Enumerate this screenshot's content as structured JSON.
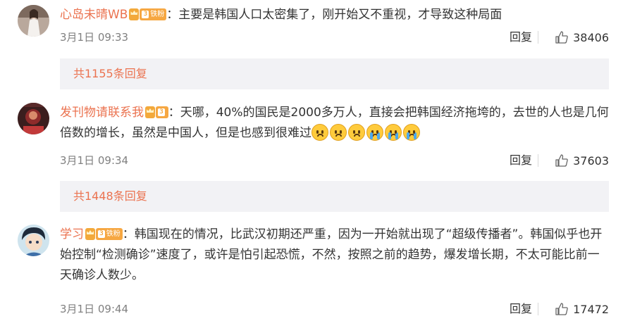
{
  "comments": [
    {
      "username": "心岛未晴WB",
      "badge_text": "铁粉",
      "text": "：主要是韩国人口太密集了，刚开始又不重视，才导致这种局面",
      "time": "3月1日 09:33",
      "reply_label": "回复",
      "likes": "38406",
      "reply_count_text": "共1155条回复"
    },
    {
      "username": "发刊物请联系我",
      "badge_text": "",
      "text": "：天哪，40%的国民是2000多万人，直接会把韩国经济拖垮的，去世的人也是几何倍数的增长，虽然是中国人，但是也感到很难过",
      "emojis": [
        "sad-face-icon",
        "sad-face-icon",
        "sad-face-icon",
        "crying-face-icon",
        "crying-face-icon",
        "crying-face-icon"
      ],
      "time": "3月1日 09:34",
      "reply_label": "回复",
      "likes": "37603",
      "reply_count_text": "共1448条回复"
    },
    {
      "username": "学习",
      "badge_text": "铁粉",
      "text": "：韩国现在的情况，比武汉初期还严重，因为一开始就出现了“超级传播者”。韩国似乎也开始控制“检测确诊”速度了，或许是怕引起恐慌，不然，按照之前的趋势，爆发增长期，不太可能比前一天确诊人数少。",
      "time": "3月1日 09:44",
      "reply_label": "回复",
      "likes": "17472"
    }
  ],
  "colors": {
    "username": "#eb7350",
    "text": "#333333",
    "meta": "#808080",
    "reply_box_bg": "#f2f2f5",
    "badge": "#f6a742"
  }
}
